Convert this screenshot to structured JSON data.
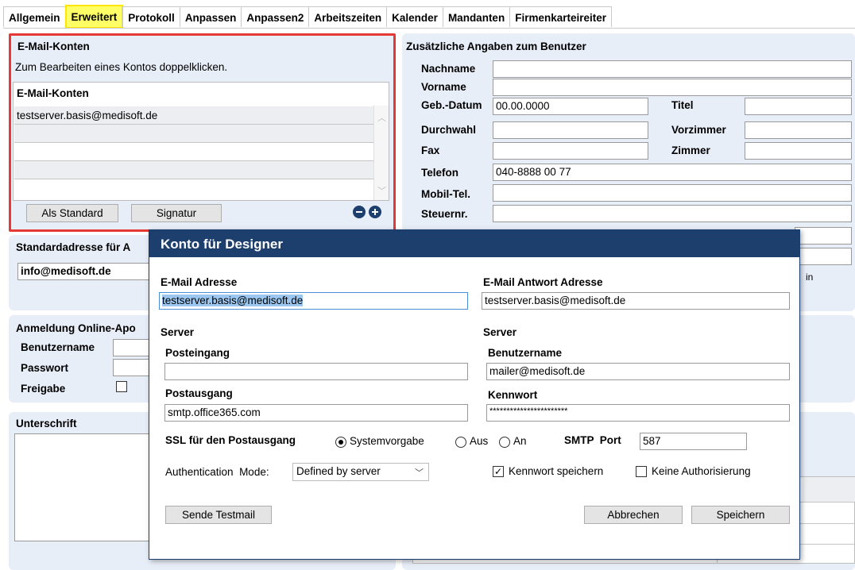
{
  "tabs": [
    "Allgemein",
    "Erweitert",
    "Protokoll",
    "Anpassen",
    "Anpassen2",
    "Arbeitszeiten",
    "Kalender",
    "Mandanten",
    "Firmenkarteireiter"
  ],
  "active_tab": "Erweitert",
  "highlight_color": "#ffff66",
  "email_accounts": {
    "title": "E-Mail-Konten",
    "hint": "Zum Bearbeiten eines Kontos doppelklicken.",
    "column_header": "E-Mail-Konten",
    "rows": [
      "testserver.basis@medisoft.de",
      "",
      "",
      "",
      ""
    ],
    "btn_standard": "Als Standard",
    "btn_signature": "Signatur",
    "remove_icon": "minus-circle-icon",
    "add_icon": "plus-circle-icon",
    "frame_color": "#e53935"
  },
  "standard_address": {
    "title": "Standardadresse für A",
    "value": "info@medisoft.de"
  },
  "online_login": {
    "title": "Anmeldung Online-Apo",
    "username_label": "Benutzername",
    "password_label": "Passwort",
    "release_label": "Freigabe"
  },
  "signature": {
    "title": "Unterschrift",
    "save_icon": "floppy-disk-icon"
  },
  "user_info": {
    "title": "Zusätzliche Angaben zum Benutzer",
    "lastname_label": "Nachname",
    "firstname_label": "Vorname",
    "birthdate_label": "Geb.-Datum",
    "birthdate_value": "00.00.0000",
    "title_label": "Titel",
    "extension_label": "Durchwahl",
    "anteroom_label": "Vorzimmer",
    "fax_label": "Fax",
    "room_label": "Zimmer",
    "phone_label": "Telefon",
    "phone_value": "040-8888 00 77",
    "mobile_label": "Mobil-Tel.",
    "tax_label": "Steuernr.",
    "partial_text": "in"
  },
  "dialog": {
    "title": "Konto für Designer",
    "header_color": "#1d3f6e",
    "email_label": "E-Mail Adresse",
    "email_value": "testserver.basis@medisoft.de",
    "reply_label": "E-Mail Antwort Adresse",
    "reply_value": "testserver.basis@medisoft.de",
    "server_left": "Server",
    "server_right": "Server",
    "incoming_label": "Posteingang",
    "incoming_value": "",
    "outgoing_label": "Postausgang",
    "outgoing_value": "smtp.office365.com",
    "username_label": "Benutzername",
    "username_value": "mailer@medisoft.de",
    "password_label": "Kennwort",
    "password_value": "***********************",
    "ssl_label": "SSL für den Postausgang",
    "ssl_options": [
      "Systemvorgabe",
      "Aus",
      "An"
    ],
    "ssl_selected": "Systemvorgabe",
    "smtp_port_label": "SMTP  Port",
    "smtp_port_value": "587",
    "auth_mode_label": "Authentication  Mode:",
    "auth_mode_value": "Defined by server",
    "save_password_label": "Kennwort speichern",
    "save_password_checked": true,
    "no_auth_label": "Keine Authorisierung",
    "no_auth_checked": false,
    "btn_testmail": "Sende Testmail",
    "btn_cancel": "Abbrechen",
    "btn_save": "Speichern"
  }
}
